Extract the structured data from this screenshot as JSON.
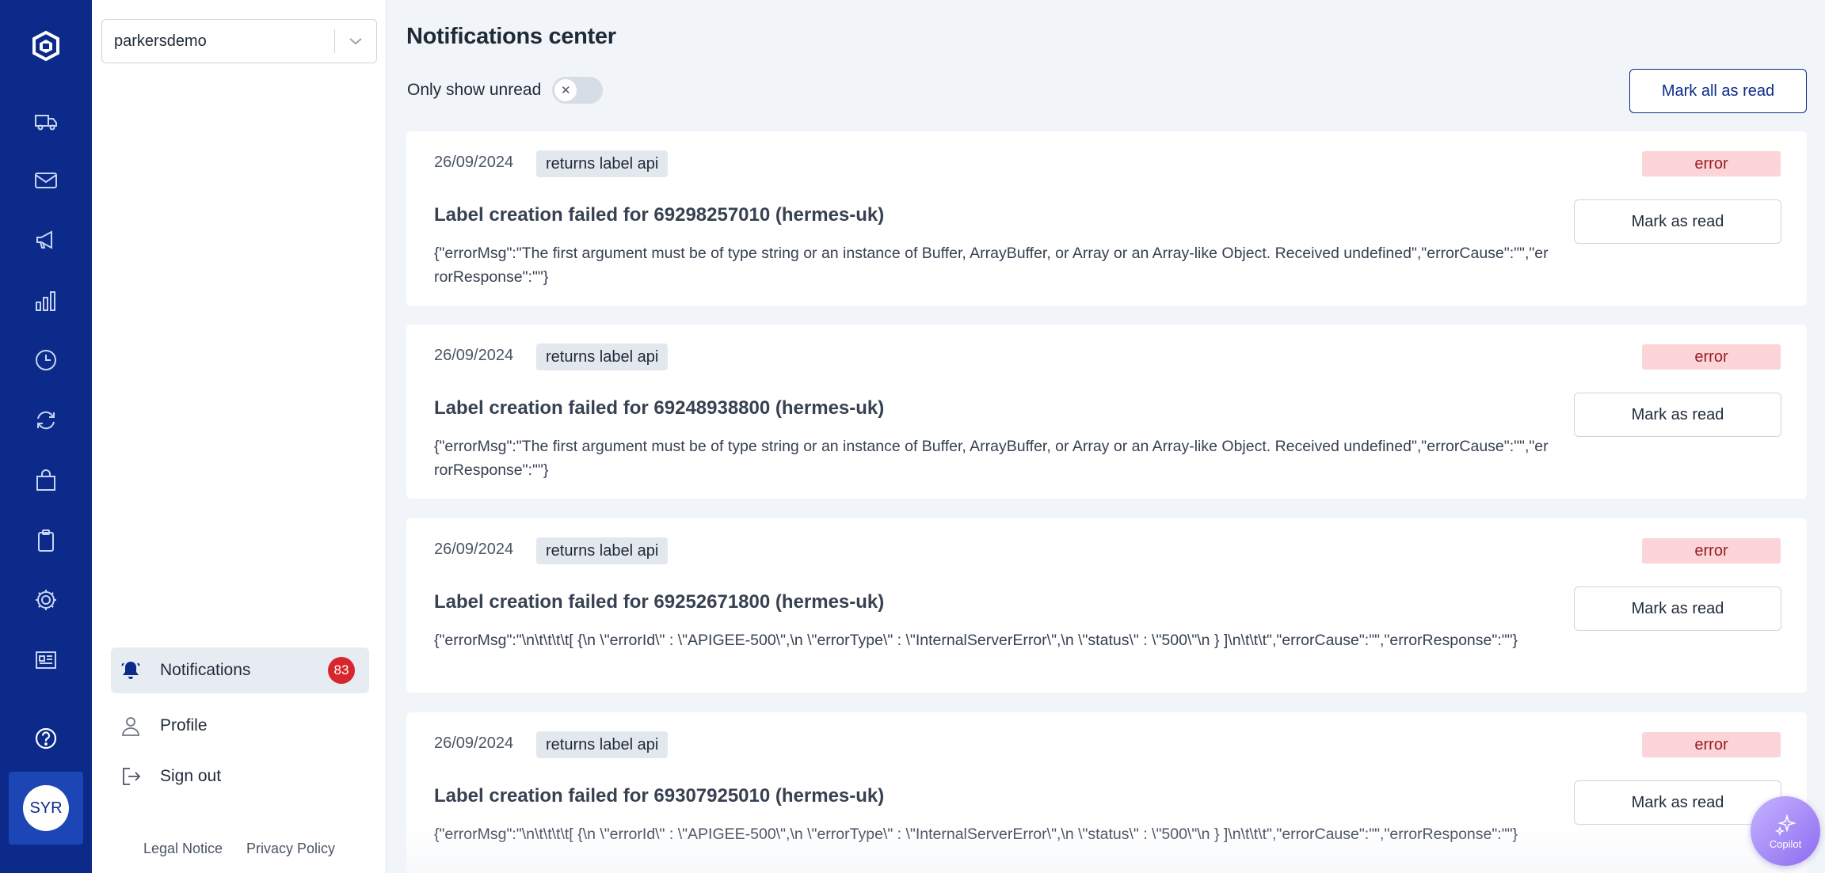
{
  "org_select": {
    "value": "parkersdemo"
  },
  "rail": {
    "icons": [
      "truck-icon",
      "mail-icon",
      "megaphone-icon",
      "bar-chart-icon",
      "clock-icon",
      "refresh-icon",
      "shopping-bag-icon",
      "clipboard-icon",
      "settings-icon",
      "newspaper-icon",
      "help-icon"
    ],
    "avatar": "SYR"
  },
  "side_nav": {
    "notifications": {
      "label": "Notifications",
      "count": "83"
    },
    "profile": {
      "label": "Profile"
    },
    "sign_out": {
      "label": "Sign out"
    }
  },
  "footer": {
    "legal": "Legal Notice",
    "privacy": "Privacy Policy"
  },
  "page": {
    "title": "Notifications center",
    "only_unread_label": "Only show unread",
    "only_unread": false,
    "mark_all_label": "Mark all as read"
  },
  "notifications": [
    {
      "date": "26/09/2024",
      "tag": "returns label api",
      "level": "error",
      "title": "Label creation failed for 69298257010 (hermes-uk)",
      "body": "{\"errorMsg\":\"The first argument must be of type string or an instance of Buffer, ArrayBuffer, or Array or an Array-like Object. Received undefined\",\"errorCause\":\"\",\"errorResponse\":\"\"}",
      "action": "Mark as read"
    },
    {
      "date": "26/09/2024",
      "tag": "returns label api",
      "level": "error",
      "title": "Label creation failed for 69248938800 (hermes-uk)",
      "body": "{\"errorMsg\":\"The first argument must be of type string or an instance of Buffer, ArrayBuffer, or Array or an Array-like Object. Received undefined\",\"errorCause\":\"\",\"errorResponse\":\"\"}",
      "action": "Mark as read"
    },
    {
      "date": "26/09/2024",
      "tag": "returns label api",
      "level": "error",
      "title": "Label creation failed for 69252671800 (hermes-uk)",
      "body": "{\"errorMsg\":\"\\n\\t\\t\\t\\t[ {\\n \\\"errorId\\\" : \\\"APIGEE-500\\\",\\n \\\"errorType\\\" : \\\"InternalServerError\\\",\\n \\\"status\\\" : \\\"500\\\"\\n } ]\\n\\t\\t\\t\",\"errorCause\":\"\",\"errorResponse\":\"\"}",
      "action": "Mark as read"
    },
    {
      "date": "26/09/2024",
      "tag": "returns label api",
      "level": "error",
      "title": "Label creation failed for 69307925010 (hermes-uk)",
      "body": "{\"errorMsg\":\"\\n\\t\\t\\t\\t[ {\\n \\\"errorId\\\" : \\\"APIGEE-500\\\",\\n \\\"errorType\\\" : \\\"InternalServerError\\\",\\n \\\"status\\\" : \\\"500\\\"\\n } ]\\n\\t\\t\\t\",\"errorCause\":\"\",\"errorResponse\":\"\"}",
      "action": "Mark as read"
    }
  ],
  "copilot": {
    "label": "Copilot"
  },
  "colors": {
    "brand": "#0b2a8a",
    "error_bg": "#fbd5d7",
    "error_text": "#9b1c23",
    "badge": "#d8262e"
  }
}
